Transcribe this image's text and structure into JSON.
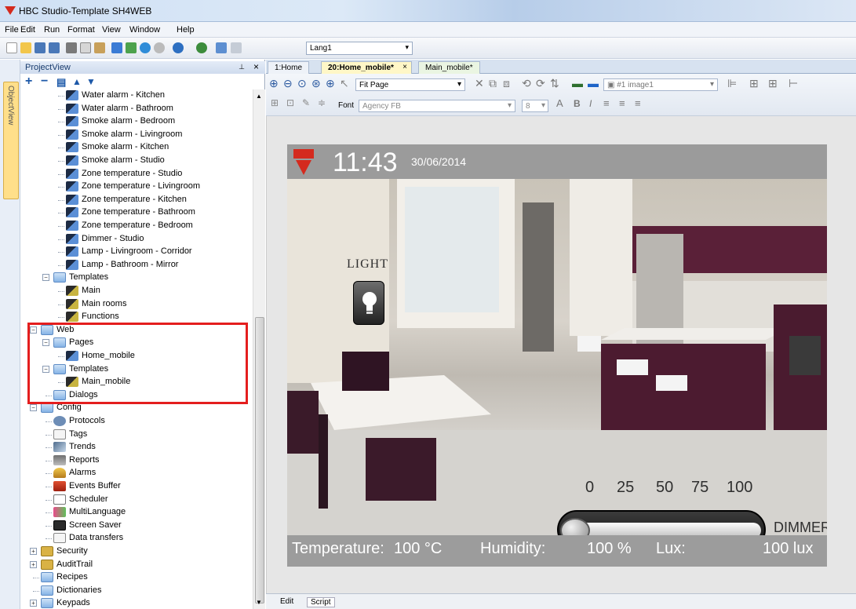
{
  "app": {
    "title": "HBC Studio-Template SH4WEB"
  },
  "menu": [
    "File",
    "Edit",
    "Run",
    "Format",
    "View",
    "Window",
    "Help"
  ],
  "toolbar": {
    "language": "Lang1"
  },
  "projectview": {
    "title": "ProjectView"
  },
  "objectview": {
    "label": "ObjectView"
  },
  "tree": [
    {
      "label": "Water alarm - Kitchen",
      "icon": "item-icon",
      "indent": 3
    },
    {
      "label": "Water alarm - Bathroom",
      "icon": "item-icon",
      "indent": 3
    },
    {
      "label": "Smoke alarm - Bedroom",
      "icon": "item-icon",
      "indent": 3
    },
    {
      "label": "Smoke alarm - Livingroom",
      "icon": "item-icon",
      "indent": 3
    },
    {
      "label": "Smoke alarm - Kitchen",
      "icon": "item-icon",
      "indent": 3
    },
    {
      "label": "Smoke alarm - Studio",
      "icon": "item-icon",
      "indent": 3
    },
    {
      "label": "Zone temperature - Studio",
      "icon": "item-icon",
      "indent": 3
    },
    {
      "label": "Zone temperature - Livingroom",
      "icon": "item-icon",
      "indent": 3
    },
    {
      "label": "Zone temperature - Kitchen",
      "icon": "item-icon",
      "indent": 3
    },
    {
      "label": "Zone temperature - Bathroom",
      "icon": "item-icon",
      "indent": 3
    },
    {
      "label": "Zone temperature - Bedroom",
      "icon": "item-icon",
      "indent": 3
    },
    {
      "label": "Dimmer - Studio",
      "icon": "item-icon",
      "indent": 3
    },
    {
      "label": "Lamp - Livingroom - Corridor",
      "icon": "item-icon",
      "indent": 3
    },
    {
      "label": "Lamp - Bathroom - Mirror",
      "icon": "item-icon",
      "indent": 3
    },
    {
      "label": "Templates",
      "icon": "folder-icon",
      "indent": 2,
      "expanded": true
    },
    {
      "label": "Main",
      "icon": "template-icon",
      "indent": 3
    },
    {
      "label": "Main rooms",
      "icon": "template-icon",
      "indent": 3
    },
    {
      "label": "Functions",
      "icon": "template-icon",
      "indent": 3
    },
    {
      "label": "Web",
      "icon": "folder-icon",
      "indent": 1,
      "expanded": true
    },
    {
      "label": "Pages",
      "icon": "folder-icon",
      "indent": 2,
      "expanded": true
    },
    {
      "label": "Home_mobile",
      "icon": "item-icon",
      "indent": 3
    },
    {
      "label": "Templates",
      "icon": "folder-icon",
      "indent": 2,
      "expanded": true
    },
    {
      "label": "Main_mobile",
      "icon": "template-icon",
      "indent": 3
    },
    {
      "label": "Dialogs",
      "icon": "folder-icon",
      "indent": 2
    },
    {
      "label": "Config",
      "icon": "folder-icon",
      "indent": 1,
      "expanded": true
    },
    {
      "label": "Protocols",
      "icon": "protocol-icon",
      "indent": 2
    },
    {
      "label": "Tags",
      "icon": "document-icon",
      "indent": 2
    },
    {
      "label": "Trends",
      "icon": "trend-icon",
      "indent": 2
    },
    {
      "label": "Reports",
      "icon": "report-icon",
      "indent": 2
    },
    {
      "label": "Alarms",
      "icon": "alarm-icon",
      "indent": 2
    },
    {
      "label": "Events Buffer",
      "icon": "events-icon",
      "indent": 2
    },
    {
      "label": "Scheduler",
      "icon": "scheduler-icon",
      "indent": 2
    },
    {
      "label": "MultiLanguage",
      "icon": "multilanguage-icon",
      "indent": 2
    },
    {
      "label": "Screen Saver",
      "icon": "screensaver-icon",
      "indent": 2
    },
    {
      "label": "Data transfers",
      "icon": "document-icon",
      "indent": 2
    },
    {
      "label": "Security",
      "icon": "lock-icon",
      "indent": 1,
      "collapsed": true
    },
    {
      "label": "AuditTrail",
      "icon": "lock-icon",
      "indent": 1,
      "collapsed": true
    },
    {
      "label": "Recipes",
      "icon": "folder-icon",
      "indent": 1
    },
    {
      "label": "Dictionaries",
      "icon": "folder-icon",
      "indent": 1
    },
    {
      "label": "Keypads",
      "icon": "folder-icon",
      "indent": 1,
      "collapsed": true
    }
  ],
  "doctabs": [
    {
      "label": "1:Home",
      "active": false
    },
    {
      "label": "20:Home_mobile*",
      "active": true
    },
    {
      "label": "Main_mobile*",
      "active": false
    }
  ],
  "editor": {
    "zoom": "Fit Page",
    "object": "#1 image1",
    "font_label": "Font",
    "font": "Agency FB",
    "font_size": "8"
  },
  "page": {
    "time": "11:43",
    "date": "30/06/2014",
    "light_label": "LIGHT",
    "scale": [
      "0",
      "25",
      "50",
      "75",
      "100"
    ],
    "slider_fraction": 0.0,
    "dimmer_label": "DIMMER",
    "temperature_label": "Temperature:",
    "temperature_value": "100 °C",
    "humidity_label": "Humidity:",
    "humidity_value": "100 %",
    "lux_label": "Lux:",
    "lux_value": "100 lux"
  },
  "bottomtabs": [
    "Edit",
    "Script"
  ]
}
